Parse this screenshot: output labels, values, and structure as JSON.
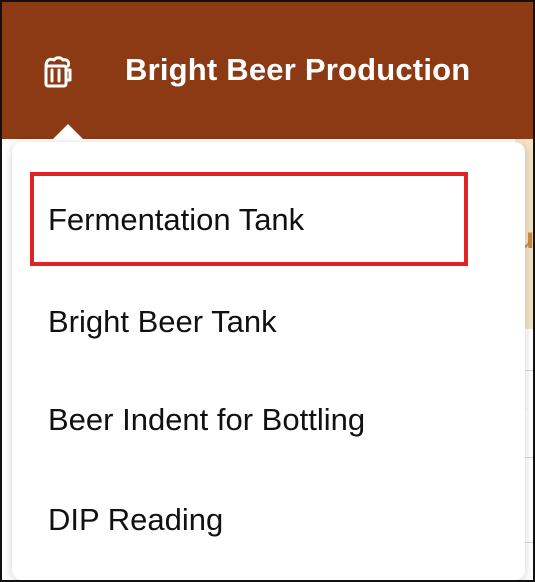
{
  "header": {
    "title": "Bright Beer Production",
    "icon": "beer-mug-icon",
    "background_color": "#8b3a14"
  },
  "menu": {
    "items": [
      {
        "label": "Fermentation Tank",
        "highlighted": true
      },
      {
        "label": "Bright Beer Tank"
      },
      {
        "label": "Beer Indent for Bottling"
      },
      {
        "label": "DIP Reading"
      }
    ]
  },
  "background": {
    "partial_char_1": "u",
    "partial_char_2": ")"
  },
  "colors": {
    "highlight": "#e02424",
    "accent_tan": "#f4e3c9"
  }
}
